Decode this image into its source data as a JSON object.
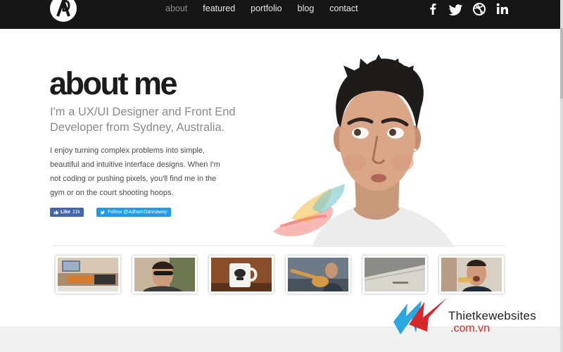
{
  "header": {
    "nav": [
      {
        "label": "about",
        "active": true
      },
      {
        "label": "featured",
        "active": false
      },
      {
        "label": "portfolio",
        "active": false
      },
      {
        "label": "blog",
        "active": false
      },
      {
        "label": "contact",
        "active": false
      }
    ],
    "social_icons": [
      "facebook-icon",
      "twitter-icon",
      "dribbble-icon",
      "linkedin-icon"
    ]
  },
  "hero": {
    "title": "about me",
    "subtitle": "I'm a UX/UI Designer and Front End Developer from Sydney, Australia.",
    "bio": "I enjoy turning complex problems into simple, beautiful and intuitive interface designs. When I'm not coding or pushing pixels, you'll find me in the gym or on the court shooting hoops.",
    "like_label": "Like",
    "like_count": "11k",
    "follow_label": "Follow @AdhamDannaway"
  },
  "gallery": {
    "thumbnails": [
      "desk-photo",
      "selfie-sunglasses-photo",
      "stormtrooper-mug-photo",
      "guitar-photo",
      "laptop-photo",
      "eating-photo"
    ]
  },
  "watermark": {
    "line1": "Thietkewebsites",
    "line2": ".com.vn"
  },
  "colors": {
    "nav_bg": "#161616",
    "facebook": "#4267b2",
    "twitter": "#1d9bf0",
    "watermark_red": "#d62828",
    "watermark_blue": "#2aa6e0"
  }
}
